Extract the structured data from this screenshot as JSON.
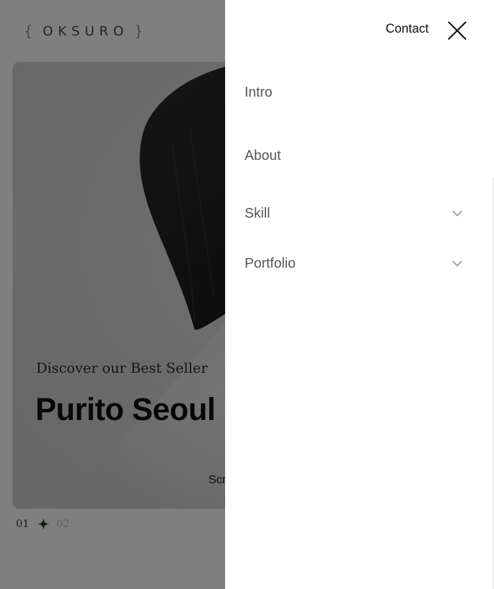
{
  "logo": {
    "open_brace": "{",
    "text": "OKSURO",
    "close_brace": "}"
  },
  "hero": {
    "subtitle": "Discover our Best Seller",
    "title": "Purito Seoul",
    "scroll_label": "Scr"
  },
  "pager": {
    "current": "01",
    "next": "02",
    "star_color": "#1f3d1f"
  },
  "drawer": {
    "contact_label": "Contact",
    "nav": [
      {
        "label": "Intro",
        "has_submenu": false
      },
      {
        "label": "About",
        "has_submenu": false
      },
      {
        "label": "Skill",
        "has_submenu": true
      },
      {
        "label": "Portfolio",
        "has_submenu": true
      }
    ]
  },
  "colors": {
    "overlay": "rgba(0,0,0,0.5)",
    "drawer_bg": "#ffffff",
    "nav_text": "#555555",
    "chevron": "#9a9a9a"
  }
}
